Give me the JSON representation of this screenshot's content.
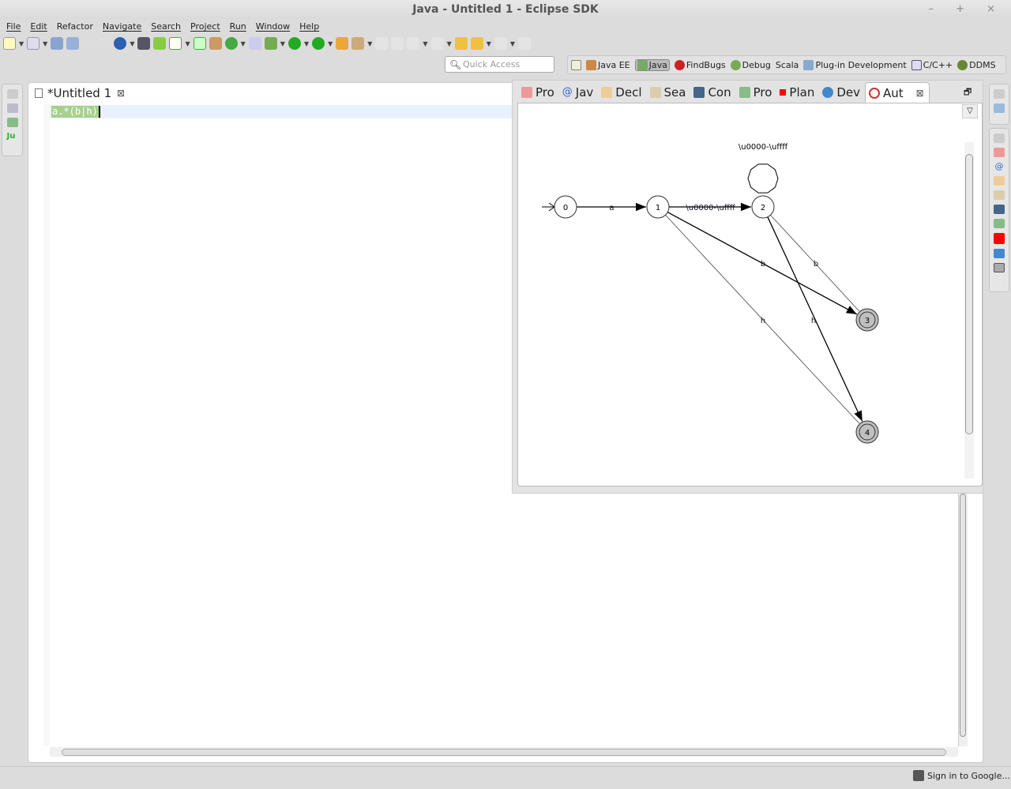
{
  "window": {
    "title": "Java - Untitled 1 - Eclipse SDK"
  },
  "menu": [
    "File",
    "Edit",
    "Refactor",
    "Navigate",
    "Search",
    "Project",
    "Run",
    "Window",
    "Help"
  ],
  "quick_access": {
    "placeholder": "Quick Access"
  },
  "perspectives": [
    {
      "label": "",
      "icon": "open-perspective-icon"
    },
    {
      "label": "Java EE",
      "icon": "java-ee-icon"
    },
    {
      "label": "Java",
      "icon": "java-icon",
      "selected": true
    },
    {
      "label": "FindBugs",
      "icon": "bug-icon"
    },
    {
      "label": "Debug",
      "icon": "debug-icon"
    },
    {
      "label": "Scala",
      "icon": ""
    },
    {
      "label": "Plug-in Development",
      "icon": "plugin-icon"
    },
    {
      "label": "C/C++",
      "icon": "cpp-icon"
    },
    {
      "label": "DDMS",
      "icon": "ddms-icon"
    }
  ],
  "editor": {
    "tab_label": "*Untitled 1",
    "content": "a.*(b|h)"
  },
  "view_tabs": [
    {
      "label": "Pro",
      "color": "#c33"
    },
    {
      "label": "Jav",
      "color": "#36c"
    },
    {
      "label": "Decl",
      "color": "#c96"
    },
    {
      "label": "Sea",
      "color": "#da8"
    },
    {
      "label": "Con",
      "color": "#369"
    },
    {
      "label": "Pro",
      "color": "#6a6"
    },
    {
      "label": "Plan",
      "color": "#f00"
    },
    {
      "label": "Dev",
      "color": "#48c"
    },
    {
      "label": "Aut",
      "color": "#c33",
      "active": true
    }
  ],
  "automaton": {
    "nodes": [
      {
        "id": "0",
        "accepting": false,
        "initial": true
      },
      {
        "id": "1",
        "accepting": false
      },
      {
        "id": "2",
        "accepting": false
      },
      {
        "id": "3",
        "accepting": true
      },
      {
        "id": "4",
        "accepting": true
      }
    ],
    "edges": [
      {
        "from": "0",
        "to": "1",
        "label": "a"
      },
      {
        "from": "1",
        "to": "2",
        "label": "\\u0000-\\uffff"
      },
      {
        "from": "2",
        "to": "2",
        "label": "\\u0000-\\uffff"
      },
      {
        "from": "1",
        "to": "3",
        "label": "b"
      },
      {
        "from": "1",
        "to": "4",
        "label": "h"
      },
      {
        "from": "2",
        "to": "3",
        "label": "b"
      },
      {
        "from": "2",
        "to": "4",
        "label": "h"
      }
    ]
  },
  "status": {
    "signin": "Sign in to Google..."
  }
}
